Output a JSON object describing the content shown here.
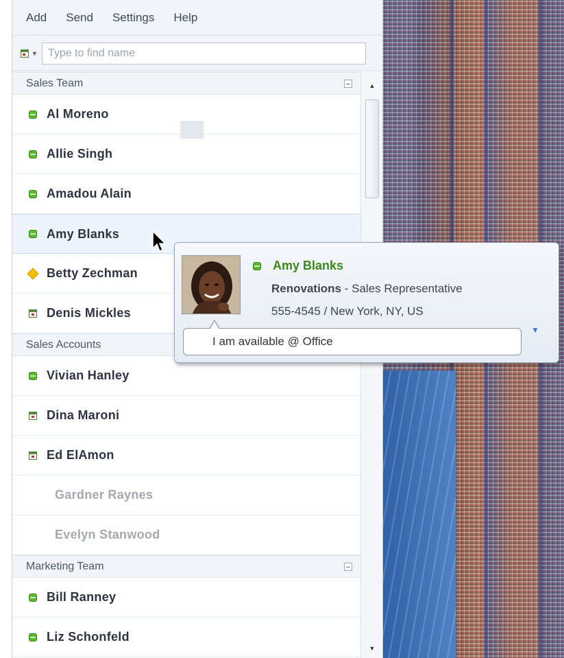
{
  "menu": [
    "Add",
    "Send",
    "Settings",
    "Help"
  ],
  "search": {
    "placeholder": "Type to find name"
  },
  "groups": [
    {
      "name": "Sales Team",
      "contacts": [
        {
          "name": "Al Moreno",
          "status": "available"
        },
        {
          "name": "Allie Singh",
          "status": "available"
        },
        {
          "name": "Amadou Alain",
          "status": "available"
        },
        {
          "name": "Amy Blanks",
          "status": "available"
        },
        {
          "name": "Betty Zechman",
          "status": "away"
        },
        {
          "name": "Denis Mickles",
          "status": "busy"
        }
      ]
    },
    {
      "name": "Sales Accounts",
      "contacts": [
        {
          "name": "Vivian Hanley",
          "status": "available"
        },
        {
          "name": "Dina Maroni",
          "status": "busy"
        },
        {
          "name": "Ed ElAmon",
          "status": "busy"
        },
        {
          "name": "Gardner Raynes",
          "status": "offline"
        },
        {
          "name": "Evelyn Stanwood",
          "status": "offline"
        }
      ]
    },
    {
      "name": "Marketing Team",
      "contacts": [
        {
          "name": "Bill Ranney",
          "status": "available"
        },
        {
          "name": "Liz Schonfeld",
          "status": "available"
        }
      ]
    }
  ],
  "card": {
    "name": "Amy Blanks",
    "company": "Renovations",
    "title": " - Sales Representative",
    "phone_location": "555-4545 / New York, NY, US",
    "note": "I am available @ Office",
    "status": "available"
  },
  "colors": {
    "available": "#5cb82e",
    "away": "#f5c000",
    "busy_red": "#c0392b",
    "card_name": "#3a8a1a"
  }
}
